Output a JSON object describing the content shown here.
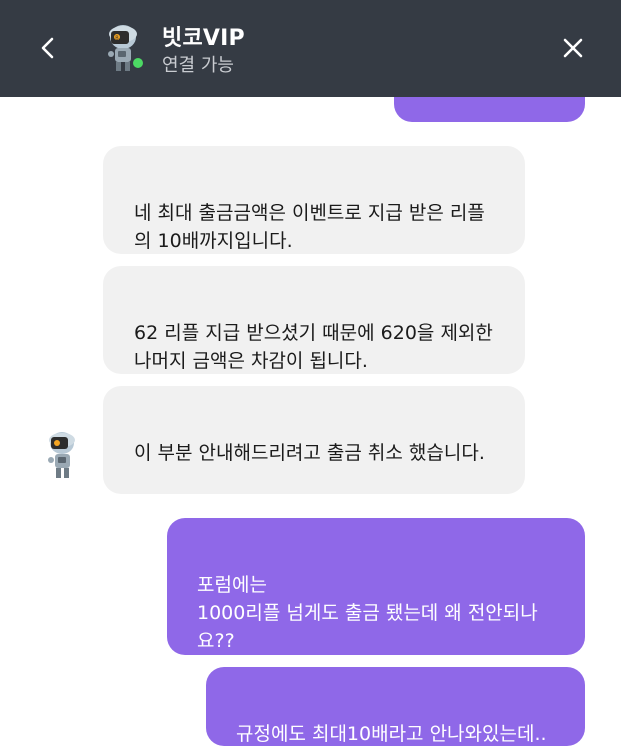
{
  "header": {
    "title": "빗코VIP",
    "status": "연결 가능",
    "colors": {
      "background": "#353b44",
      "online": "#4cd964"
    },
    "icons": {
      "back": "chevron-left-icon",
      "close": "close-icon",
      "avatar": "robot-avatar-icon"
    }
  },
  "messages": [
    {
      "side": "agent",
      "text": "네 최대 출금금액은 이벤트로 지급 받은 리플의 10배까지입니다."
    },
    {
      "side": "agent",
      "text": "62 리플 지급 받으셨기 때문에 620을 제외한 나머지 금액은 차감이 됩니다."
    },
    {
      "side": "agent",
      "text": "이 부분 안내해드리려고 출금 취소 했습니다."
    },
    {
      "side": "user",
      "text": "포럼에는\n1000리플 넘게도 출금 됐는데 왜 전안되나요??"
    },
    {
      "side": "user",
      "text": "규정에도 최대10배라고 안나와있는데.."
    }
  ],
  "colors": {
    "agent_bubble": "#f1f1f1",
    "user_bubble": "#8f68e8"
  }
}
